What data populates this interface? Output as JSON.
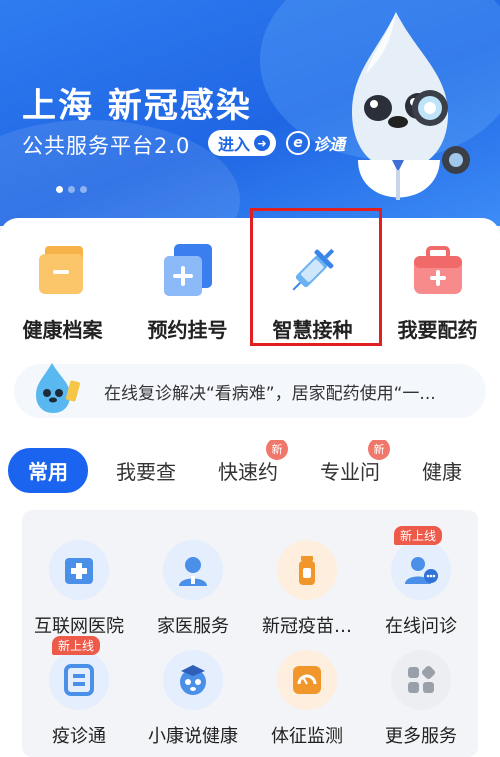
{
  "banner": {
    "title": "上海 新冠感染",
    "subtitle": "公共服务平台2.0",
    "enter_label": "进入",
    "logo_text": "诊通",
    "logo_mark": "e"
  },
  "quick_entries": [
    {
      "label": "健康档案",
      "icon": "health-file-icon"
    },
    {
      "label": "预约挂号",
      "icon": "appointment-icon"
    },
    {
      "label": "智慧接种",
      "icon": "vaccine-syringe-icon"
    },
    {
      "label": "我要配药",
      "icon": "medicine-kit-icon"
    }
  ],
  "notice": {
    "text": "在线复诊解决“看病难”，居家配药使用“一..."
  },
  "tabs": [
    {
      "label": "常用",
      "active": true
    },
    {
      "label": "我要查",
      "active": false
    },
    {
      "label": "快速约",
      "active": false,
      "badge": "新"
    },
    {
      "label": "专业问",
      "active": false,
      "badge": "新"
    },
    {
      "label": "健康",
      "active": false
    }
  ],
  "services": [
    {
      "label": "互联网医院",
      "icon": "internet-hospital-icon",
      "color": "#4a8fe8"
    },
    {
      "label": "家医服务",
      "icon": "family-doctor-icon",
      "color": "#4a8fe8"
    },
    {
      "label": "新冠疫苗…",
      "icon": "covid-vaccine-icon",
      "color": "#f0962a"
    },
    {
      "label": "在线问诊",
      "icon": "online-consult-icon",
      "color": "#4a8fe8",
      "badge": "新上线"
    },
    {
      "label": "疫诊通",
      "icon": "yizhentong-icon",
      "color": "#4a8fe8",
      "badge": "新上线"
    },
    {
      "label": "小康说健康",
      "icon": "xiaokang-icon",
      "color": "#4a8fe8"
    },
    {
      "label": "体征监测",
      "icon": "vital-sign-icon",
      "color": "#f0962a"
    },
    {
      "label": "更多服务",
      "icon": "more-services-icon",
      "color": "#9aa0aa"
    }
  ],
  "colors": {
    "primary": "#1a64f0",
    "highlight_box": "#e21f1f",
    "badge": "#ee5a4a"
  }
}
